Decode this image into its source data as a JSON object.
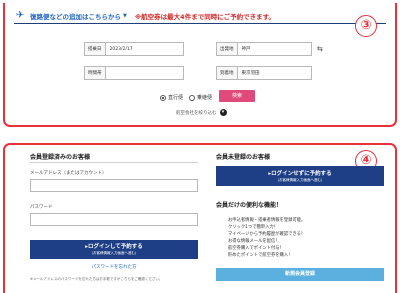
{
  "top": {
    "header_text": "復路便などの追加はこちらから",
    "header_note": "※航空券は最大4件まで同時にご予約できます。",
    "step_number": "③",
    "departure_date_label": "搭乗日",
    "departure_date_value": "2023/2/17",
    "time_label": "時間帯",
    "from_label": "出発地",
    "from_value": "神戸",
    "to_label": "到着地",
    "to_value": "東京羽田",
    "radio_direct": "直行便",
    "radio_connecting": "乗継便",
    "search_button": "検索",
    "narrow_link": "航空会社を絞り込む"
  },
  "bottom": {
    "step_number": "④",
    "members_title": "会員登録済みのお客様",
    "email_label": "メールアドレス（またはアカウント）",
    "password_label": "パスワード",
    "login_button": "ログインして予約する",
    "login_button_sub": "(お客様情報入力画面へ進む)",
    "forgot_link": "パスワードを忘れた方",
    "fine_print": "※メールアドレスのパスワードを忘れた方はお手数ですがこちらをご確認ください。",
    "guest_title": "会員未登録のお客様",
    "guest_button": "ログインせずに予約する",
    "guest_button_sub": "(お客様情報入力画面へ進む)",
    "benefits_title": "会員だけの便利な機能！",
    "benefits": [
      "お申込者情報・搭乗者情報を登録可能。",
      "クリック1つで簡単入力！",
      "マイページから予約履歴が確認できる！",
      "お得な情報メールを配信！",
      "航空券購入でポイント付与！",
      "貯めたポイントで航空券を購入！"
    ],
    "register_button": "新規会員登録"
  },
  "colors": {
    "frame_red": "#e8313b",
    "navy": "#1e3f86",
    "header_blue": "#1e64c8",
    "pink": "#e04a7a",
    "light_blue": "#5bb0e0"
  }
}
